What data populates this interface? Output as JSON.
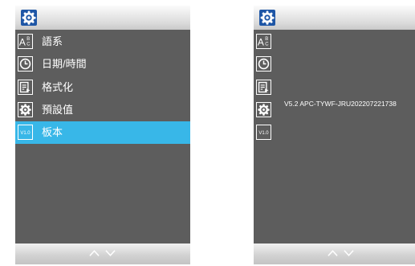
{
  "colors": {
    "panel_background": "#5d5d5d",
    "selected_highlight": "#38b7e8",
    "title_icon_background": "#1e56a6",
    "text": "#ffffff"
  },
  "left_screen": {
    "title_icon": "gear-icon",
    "menu": [
      {
        "icon": "language-icon",
        "label": "語系",
        "selected": false
      },
      {
        "icon": "clock-icon",
        "label": "日期/時間",
        "selected": false
      },
      {
        "icon": "format-icon",
        "label": "格式化",
        "selected": false
      },
      {
        "icon": "gear-icon",
        "label": "預設值",
        "selected": false
      },
      {
        "icon": "version-icon",
        "icon_text": "V1.0",
        "label": "板本",
        "selected": true
      }
    ],
    "nav": {
      "up_icon": "chevron-up-icon",
      "down_icon": "chevron-down-icon"
    }
  },
  "right_screen": {
    "title_icon": "gear-icon",
    "menu_icons": [
      "language-icon",
      "clock-icon",
      "format-icon",
      "gear-icon",
      "version-icon"
    ],
    "version_icon_text": "V1.0",
    "version_info": "V5.2 APC-TYWF-JRU202207221738",
    "nav": {
      "up_icon": "chevron-up-icon",
      "down_icon": "chevron-down-icon"
    }
  }
}
